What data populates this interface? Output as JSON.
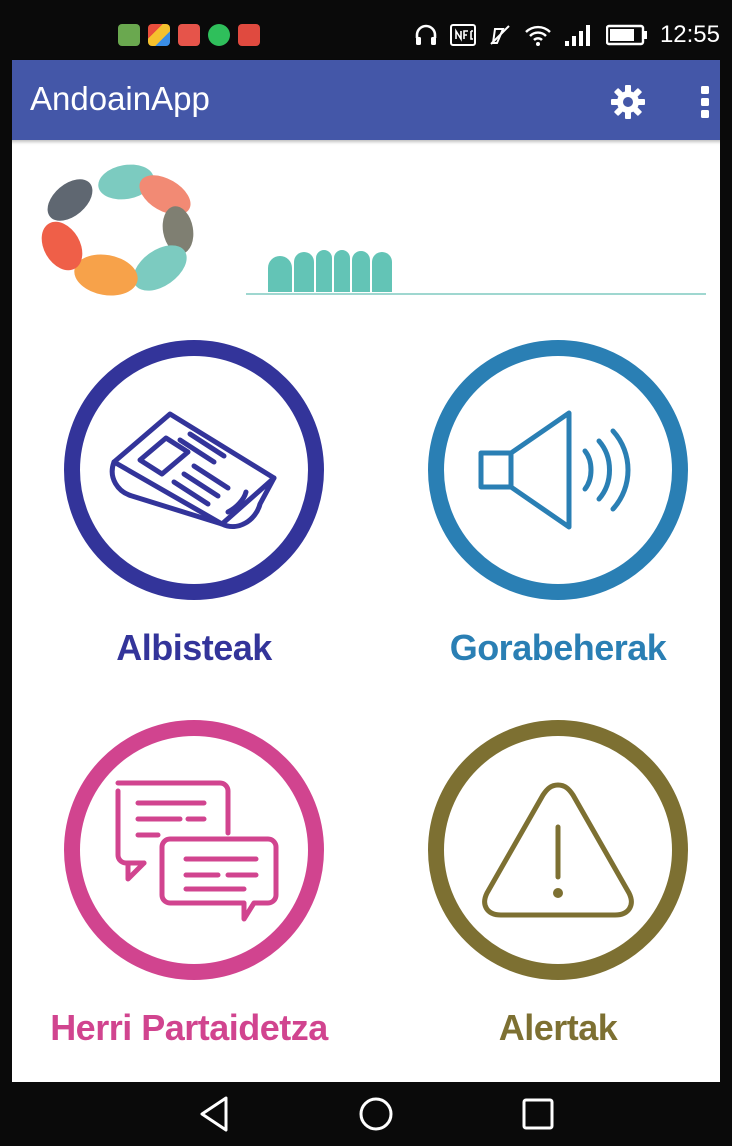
{
  "app": {
    "title": "AndoainApp",
    "bar_color": "#4457a8"
  },
  "status_bar": {
    "time": "12:55",
    "notification_icons": [
      "android-icon",
      "puzzle-icon",
      "app-icon",
      "whatsapp-icon",
      "gmail-icon"
    ],
    "system_icons": [
      "headphones-icon",
      "nfc-icon",
      "vibrate-off-icon",
      "wifi-icon",
      "signal-icon",
      "battery-icon"
    ]
  },
  "toolbar": {
    "actions": [
      "gear-icon",
      "overflow-menu-icon"
    ]
  },
  "tiles": [
    {
      "label": "Albisteak",
      "icon": "newspaper-icon",
      "color": "#33349a"
    },
    {
      "label": "Gorabeherak",
      "icon": "speaker-icon",
      "color": "#2a7fb4"
    },
    {
      "label": "Herri Partaidetza",
      "icon": "chat-bubbles-icon",
      "color": "#d1448f"
    },
    {
      "label": "Alertak",
      "icon": "warning-icon",
      "color": "#7d7032"
    }
  ],
  "nav_bar": {
    "buttons": [
      "back-icon",
      "home-icon",
      "recents-icon"
    ]
  }
}
